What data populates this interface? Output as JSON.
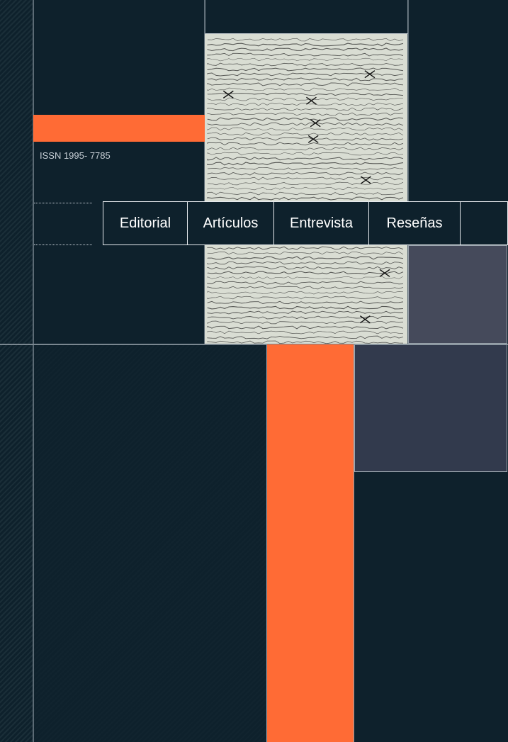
{
  "journal": {
    "issn": "ISSN 1995- 7785"
  },
  "nav": {
    "items": [
      {
        "label": "Editorial"
      },
      {
        "label": "Artículos"
      },
      {
        "label": "Entrevista"
      },
      {
        "label": "Reseñas"
      }
    ]
  },
  "colors": {
    "background": "#0e212c",
    "accent_orange": "#ff6b35",
    "grey_panel": "#454a5b",
    "slate_panel": "#323a4d"
  }
}
